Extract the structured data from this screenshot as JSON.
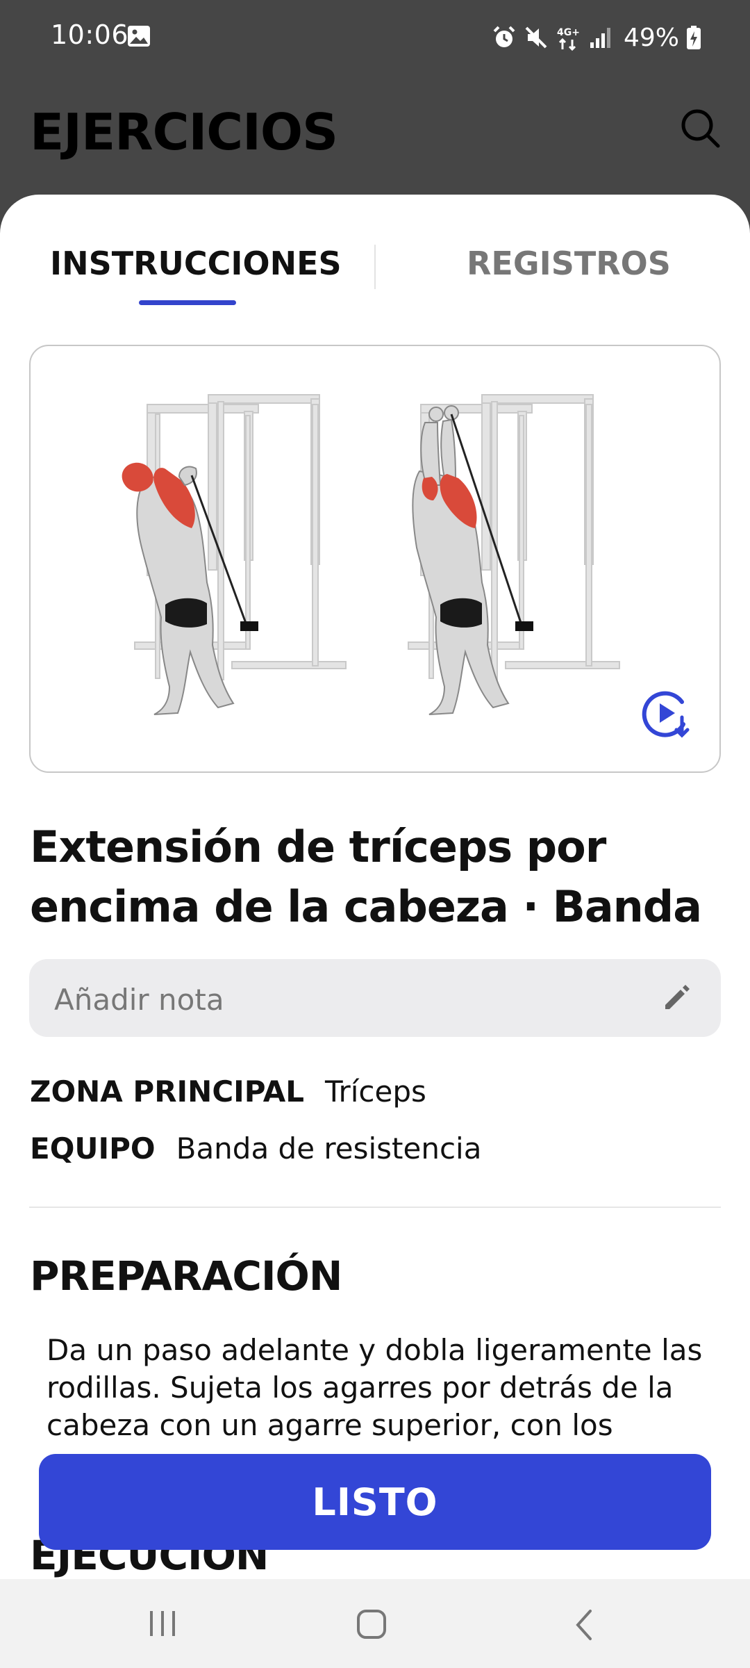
{
  "status_bar": {
    "time": "10:06",
    "battery": "49%",
    "network": "4G+"
  },
  "header": {
    "title": "EJERCICIOS",
    "search_icon": "search-icon"
  },
  "tabs": [
    {
      "label": "INSTRUCCIONES",
      "active": true
    },
    {
      "label": "REGISTROS",
      "active": false
    }
  ],
  "exercise": {
    "title": "Extensión de tríceps por encima de la cabeza · Banda",
    "note_placeholder": "Añadir nota",
    "meta": [
      {
        "key": "ZONA PRINCIPAL",
        "value": "Tríceps"
      },
      {
        "key": "EQUIPO",
        "value": "Banda de resistencia"
      }
    ]
  },
  "sections": {
    "preparation_title": "PREPARACIÓN",
    "preparation_text": "Da un paso adelante y dobla ligeramente las rodillas. Sujeta los agarres por detrás de la cabeza con un agarre superior, con los",
    "execution_title": "EJECUCIÓN"
  },
  "actions": {
    "done_label": "LISTO"
  },
  "colors": {
    "accent": "#3346d6",
    "header_bg": "#464646",
    "muscle_highlight": "#d94a3a"
  }
}
